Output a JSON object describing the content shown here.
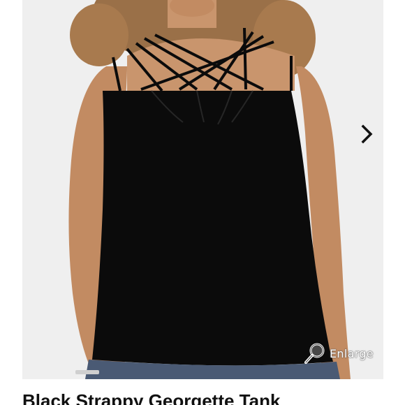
{
  "product": {
    "title": "Black Strappy Georgette Tank",
    "image_alt": "Black strappy georgette tank top worn by model"
  },
  "gallery": {
    "next_icon": "chevron-right-icon",
    "enlarge_label": "Enlarge",
    "enlarge_icon": "magnifier-icon"
  },
  "colors": {
    "background": "#ffffff",
    "image_background": "#efefef",
    "garment": "#0b0b0b",
    "title_text": "#111111"
  }
}
